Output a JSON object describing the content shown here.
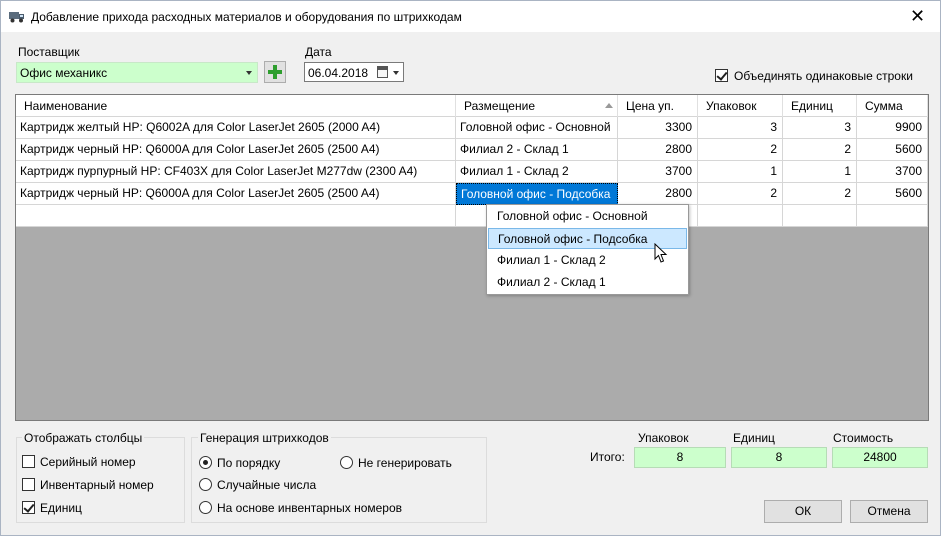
{
  "window": {
    "title": "Добавление прихода расходных материалов и оборудования по штрихкодам",
    "close_glyph": "✕"
  },
  "supplier": {
    "label": "Поставщик",
    "value": "Офис механикс"
  },
  "date": {
    "label": "Дата",
    "value": "06.04.2018"
  },
  "merge_rows": {
    "label": "Объединять одинаковые строки",
    "checked": true
  },
  "grid": {
    "columns": [
      "Наименование",
      "Размещение",
      "Цена уп.",
      "Упаковок",
      "Единиц",
      "Сумма"
    ],
    "rows": [
      [
        "Картридж желтый HP: Q6002A для Color LaserJet 2605 (2000 A4)",
        "Головной офис - Основной",
        "3300",
        "3",
        "3",
        "9900"
      ],
      [
        "Картридж черный HP: Q6000A для Color LaserJet 2605 (2500 A4)",
        "Филиал 2 - Склад 1",
        "2800",
        "2",
        "2",
        "5600"
      ],
      [
        "Картридж пурпурный HP: CF403X для Color LaserJet M277dw (2300 A4)",
        "Филиал 1 - Склад 2",
        "3700",
        "1",
        "1",
        "3700"
      ],
      [
        "Картридж черный HP: Q6000A для Color LaserJet 2605 (2500 A4)",
        "Головной офис - Подсобка",
        "2800",
        "2",
        "2",
        "5600"
      ]
    ],
    "selected_row": 3,
    "selected_column": 1
  },
  "placement_dropdown": {
    "options": [
      "Головной офис - Основной",
      "Головной офис - Подсобка",
      "Филиал 1 - Склад 2",
      "Филиал 2 - Склад 1"
    ],
    "highlighted": 1
  },
  "show_columns": {
    "title": "Отображать столбцы",
    "items": [
      {
        "label": "Серийный номер",
        "checked": false
      },
      {
        "label": "Инвентарный номер",
        "checked": false
      },
      {
        "label": "Единиц",
        "checked": true
      }
    ]
  },
  "barcode_generation": {
    "title": "Генерация штрихкодов",
    "options": [
      {
        "label": "По порядку",
        "checked": true
      },
      {
        "label": "Не генерировать",
        "checked": false
      },
      {
        "label": "Случайные числа",
        "checked": false
      },
      {
        "label": "На основе инвентарных номеров",
        "checked": false
      }
    ]
  },
  "totals": {
    "label": "Итого:",
    "packages_label": "Упаковок",
    "packages": "8",
    "units_label": "Единиц",
    "units": "8",
    "cost_label": "Стоимость",
    "cost": "24800"
  },
  "buttons": {
    "ok": "ОК",
    "cancel": "Отмена"
  },
  "colors": {
    "accent": "#0078d7",
    "highlight_green": "#ccffcc",
    "add_icon": "#2e9e2e",
    "dropdown_highlight": "#cce8ff"
  },
  "icons": {
    "window": "truck-icon",
    "add": "plus-icon",
    "calendar": "calendar-icon",
    "close": "close-icon"
  }
}
